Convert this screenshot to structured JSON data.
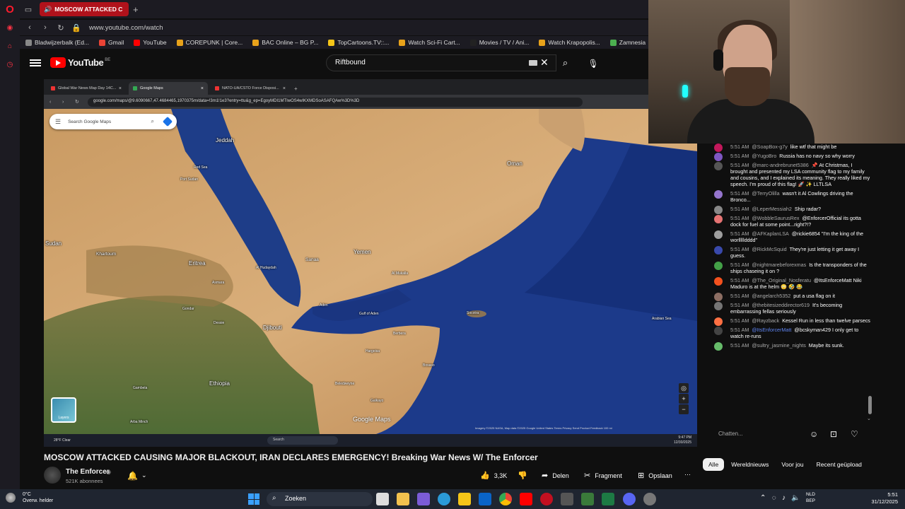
{
  "browser": {
    "active_tab_title": "MOSCOW ATTACKED C",
    "url": "www.youtube.com/watch",
    "bookmarks": [
      "Bladwijzerbalk (Ed...",
      "Gmail",
      "YouTube",
      "COREPUNK | Core...",
      "BAC Online – BG P...",
      "TopCartoons.TV::...",
      "Watch Sci-Fi Cart...",
      "Movies / TV / Ani...",
      "Watch Krapopolis...",
      "Zamnesia"
    ]
  },
  "youtube": {
    "logo_text": "YouTube",
    "country_code": "BE",
    "search_value": "Riftbound"
  },
  "video": {
    "inner_tabs": [
      "Global War News Map Day 14C...",
      "Google Maps",
      "NATO-UA/CSTO Force Disposi..."
    ],
    "inner_url": "google.com/maps/@9.6090667,47.4684465,1970375m/data=!3m1!1e3?entry=ttu&g_ep=EgoyMDI1MTIwOS4wIKXMDSoASAFQAw%3D%3D",
    "gmaps_search_placeholder": "Search Google Maps",
    "layers_label": "Layers",
    "google_watermark": "Google Maps",
    "map_footer": "Imagery ©2025 NASA, Map data ©2025 Google   United States   Terms   Privacy   Send Product Feedback   100 mi",
    "map_labels": {
      "oman": "Oman",
      "yemen": "Yemen",
      "sanaa": "Sanaa",
      "eritrea": "Eritrea",
      "djibouti": "Djibouti",
      "ethiopia": "Ethiopia",
      "sudan": "Sudan",
      "khartoum": "Khartoum",
      "jeddah": "Jeddah",
      "red_sea": "Red Sea",
      "port_sudan": "Port Sudan",
      "gulf_of_aden": "Gulf of Aden",
      "aden": "Aden",
      "al_mukalla": "Al Mukalla",
      "socotra": "Socotra",
      "arabian_sea": "Arabian Sea",
      "al_hudaydah": "Al Hudaydah",
      "asmara": "Asmara",
      "gondar": "Gondar",
      "dessie": "Dessie",
      "berbera": "Berbera",
      "hargeisa": "Hargeisa",
      "bosaso": "Bosaso",
      "gambela": "Gambela",
      "galkayo": "Galkayo",
      "beledweyne": "Beledweyne",
      "arba_minch": "Arba Minch"
    },
    "inner_taskbar": {
      "weather_temp": "28°F",
      "weather_desc": "Clear",
      "search": "Search",
      "time": "9:47 PM",
      "date": "12/30/2025"
    },
    "title": "MOSCOW ATTACKED CAUSING MAJOR BLACKOUT, IRAN DECLARES EMERGENCY! Breaking War News W/ The Enforcer",
    "channel_name": "The Enforcer",
    "subscribers": "521K abonnees",
    "likes": "3,3K",
    "share_label": "Delen",
    "clip_label": "Fragment",
    "save_label": "Opslaan"
  },
  "chat": {
    "messages": [
      {
        "time": "5:51 AM",
        "user": "@SoapBox-g7y",
        "text": "like wtf that might be",
        "color": "#c2185b"
      },
      {
        "time": "5:51 AM",
        "user": "@YugoBro",
        "text": "Russia has no navy so why worry",
        "color": "#7e57c2"
      },
      {
        "time": "5:51 AM",
        "user": "@marc-andrebrunet5386",
        "text": "📌 At Christmas, I brought and presented my LSA community flag to my family and cousins, and I explained its meaning. They really liked my speech. I'm proud of this flag! 🚀 ✨ LLTLSA",
        "color": "#555555"
      },
      {
        "time": "5:51 AM",
        "user": "@TerryOlilla",
        "text": "wasn't it Al Cowlings driving the Bronco...",
        "color": "#9575cd"
      },
      {
        "time": "5:51 AM",
        "user": "@LeperMessiah2",
        "text": "Ship radar?",
        "color": "#888888"
      },
      {
        "time": "5:51 AM",
        "user": "@WobbleSaurusRex",
        "text": "@EnforcerOfficial its gotta dock for fuel at some point...right?!?",
        "color": "#e57373"
      },
      {
        "time": "5:51 AM",
        "user": "@AFKaplanLSA",
        "text": "@rickie6854 \"I'm the king of the worllllldddd\"",
        "color": "#9e9e9e"
      },
      {
        "time": "5:51 AM",
        "user": "@RickMcSquid",
        "text": "They're just letting it get away I guess.",
        "color": "#3949ab"
      },
      {
        "time": "5:51 AM",
        "user": "@nightmarebeforexmas",
        "text": "Is the transponders of the ships chaseing it on ?",
        "color": "#43a047"
      },
      {
        "time": "5:51 AM",
        "user": "@The_Original_Nosferatu",
        "text": "@ItsEnforceMatt Niki Maduro is at the helm 😳 🤣 😂",
        "color": "#f4511e"
      },
      {
        "time": "5:51 AM",
        "user": "@angelarch5352",
        "text": "put a usa flag on it",
        "color": "#8d6e63"
      },
      {
        "time": "5:51 AM",
        "user": "@thebitesizeddirector619",
        "text": "It's becoming embarrassing fellas seriously",
        "color": "#757575"
      },
      {
        "time": "5:51 AM",
        "user": "@Rayzback",
        "text": "Kessel Run in less than twelve parsecs",
        "color": "#ff7043"
      },
      {
        "time": "5:51 AM",
        "user": "@ItsEnforcerMatt",
        "text": "@bcskyman429 I only get to watch re-runs",
        "color": "#444444",
        "mod": true
      },
      {
        "time": "5:51 AM",
        "user": "@sultry_jasmine_nights",
        "text": "Maybe its sunk.",
        "color": "#66bb6a"
      }
    ],
    "input_placeholder": "Chatten..."
  },
  "chips": [
    "Alle",
    "Wereldnieuws",
    "Voor jou",
    "Recent geüpload"
  ],
  "taskbar": {
    "weather_temp": "0°C",
    "weather_desc": "Overw. helder",
    "search": "Zoeken",
    "lang1": "NLD",
    "lang2": "BEP",
    "time": "5:51",
    "date": "31/12/2025"
  },
  "colors": {
    "youtube_red": "#ff0000",
    "opera_red": "#ff1b2d",
    "tab_red": "#b0121b",
    "sea_blue": "#1c3a8a"
  }
}
